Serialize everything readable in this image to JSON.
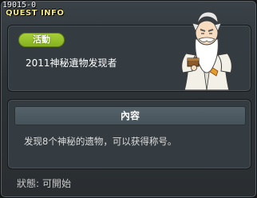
{
  "quest": {
    "id": "19015-0",
    "header_title": "QUEST INFO"
  },
  "info": {
    "category_badge": "活動",
    "name": "2011神秘遺物发现者"
  },
  "content": {
    "header": "內容",
    "description": "发现8个神秘的遗物，可以获得称号。"
  },
  "status": {
    "label": "狀態:",
    "value": "可開始"
  },
  "colors": {
    "title": "#f4e98a",
    "badge": "#9bc632",
    "panel": "#353c41"
  },
  "npc_icon": "old-sage-npc-icon"
}
